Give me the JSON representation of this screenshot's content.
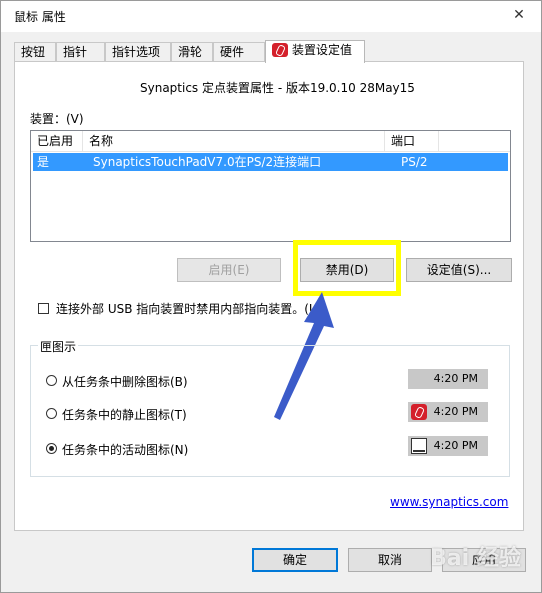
{
  "window": {
    "title": "鼠标 属性",
    "close_glyph": "✕"
  },
  "tabs": [
    {
      "label": "按钮"
    },
    {
      "label": "指针"
    },
    {
      "label": "指针选项"
    },
    {
      "label": "滑轮"
    },
    {
      "label": "硬件"
    },
    {
      "label": "装置设定值",
      "active": true
    }
  ],
  "panel": {
    "header": "Synaptics 定点装置属性 - 版本19.0.10 28May15",
    "device_label": "装置：(V)",
    "columns": [
      "已启用",
      "名称",
      "端口"
    ],
    "rows": [
      {
        "enabled": "是",
        "name": "SynapticsTouchPadV7.0在PS/2连接端口",
        "port": "PS/2"
      }
    ],
    "buttons": {
      "enable": "启用(E)",
      "disable": "禁用(D)",
      "settings": "设定值(S)..."
    },
    "checkbox_label": "连接外部 USB 指向装置时禁用内部指向装置。(U)",
    "tray_group": {
      "title": "匣图示",
      "options": [
        {
          "label": "从任务条中删除图标(B)",
          "time": "4:20 PM",
          "icon": "none",
          "checked": false
        },
        {
          "label": "任务条中的静止图标(T)",
          "time": "4:20 PM",
          "icon": "synaptics-red-icon",
          "checked": false
        },
        {
          "label": "任务条中的活动图标(N)",
          "time": "4:20 PM",
          "icon": "touchpad-icon",
          "checked": true
        }
      ]
    },
    "link": "www.synaptics.com"
  },
  "footer": {
    "ok": "确定",
    "cancel": "取消",
    "apply": "应用"
  },
  "watermark": "Bai 经验",
  "colors": {
    "selection": "#3399ff",
    "highlight_box": "#ffff00",
    "arrow": "#3b5bc9",
    "accent": "#0078d7"
  }
}
